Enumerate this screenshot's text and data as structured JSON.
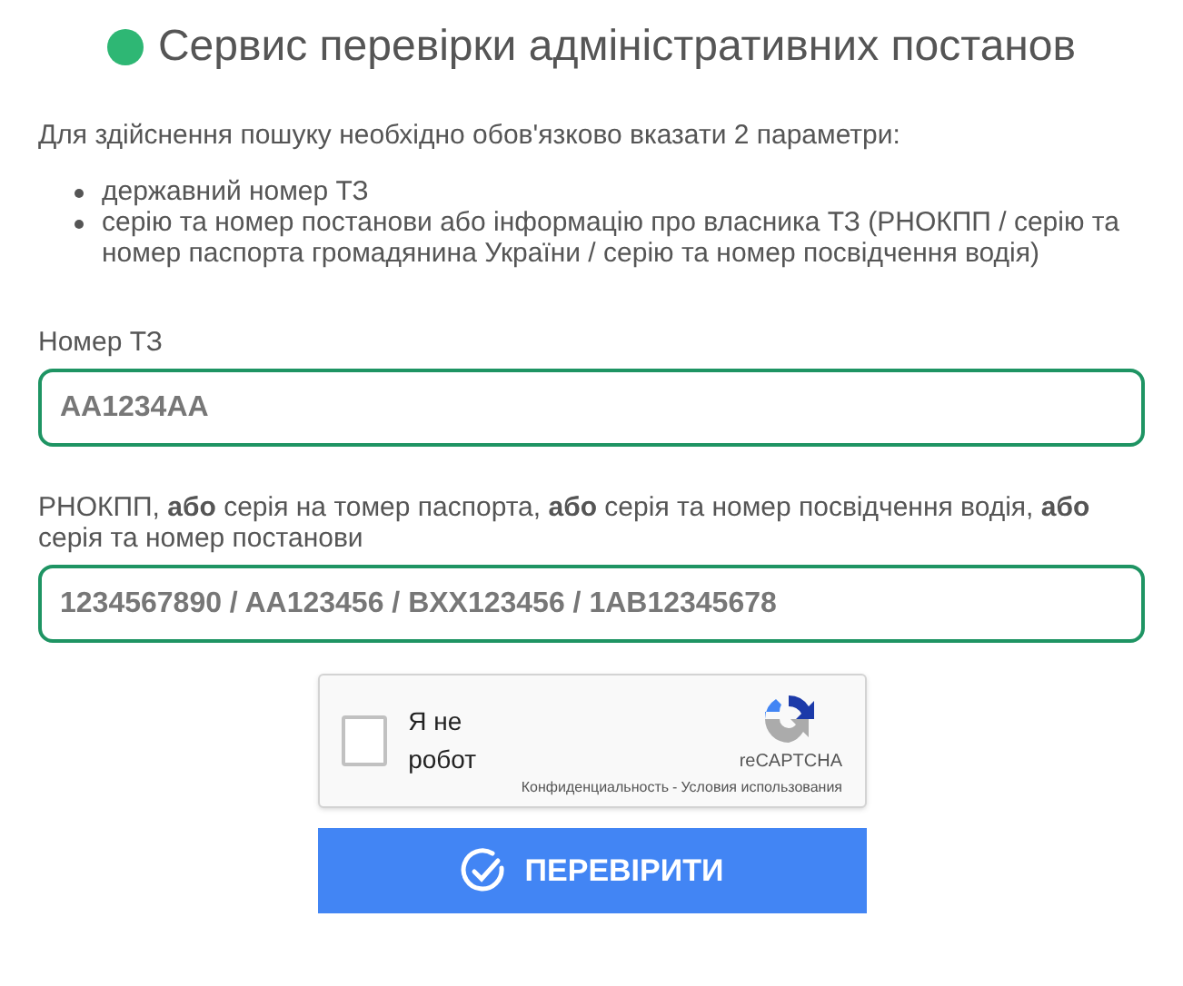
{
  "title": "Сервис перевірки адміністративних постанов",
  "intro": "Для здійснення пошуку необхідно обов'язково вказати 2 параметри:",
  "requirements": [
    "державний номер ТЗ",
    "серію та номер постанови або інформацію про власника ТЗ (РНОКПП / серію та номер паспорта громадянина України / серію та номер посвідчення водія)"
  ],
  "fields": [
    {
      "label": "Номер ТЗ",
      "placeholder": "AA1234AA"
    },
    {
      "label": "РНОКПП, **або** серія на томер паспорта, **або** серія та номер посвідчення водія, **або** серія та номер постанови",
      "placeholder": "1234567890 / AA123456 / BXX123456 / 1AB12345678"
    }
  ],
  "captcha": {
    "label": "Я не робот",
    "checked": false,
    "brand": "reCAPTCHA",
    "privacy_link": "Конфиденциальность",
    "separator": "-",
    "terms_link": "Условия использования"
  },
  "submit_button": "ПЕРЕВІРИТИ"
}
